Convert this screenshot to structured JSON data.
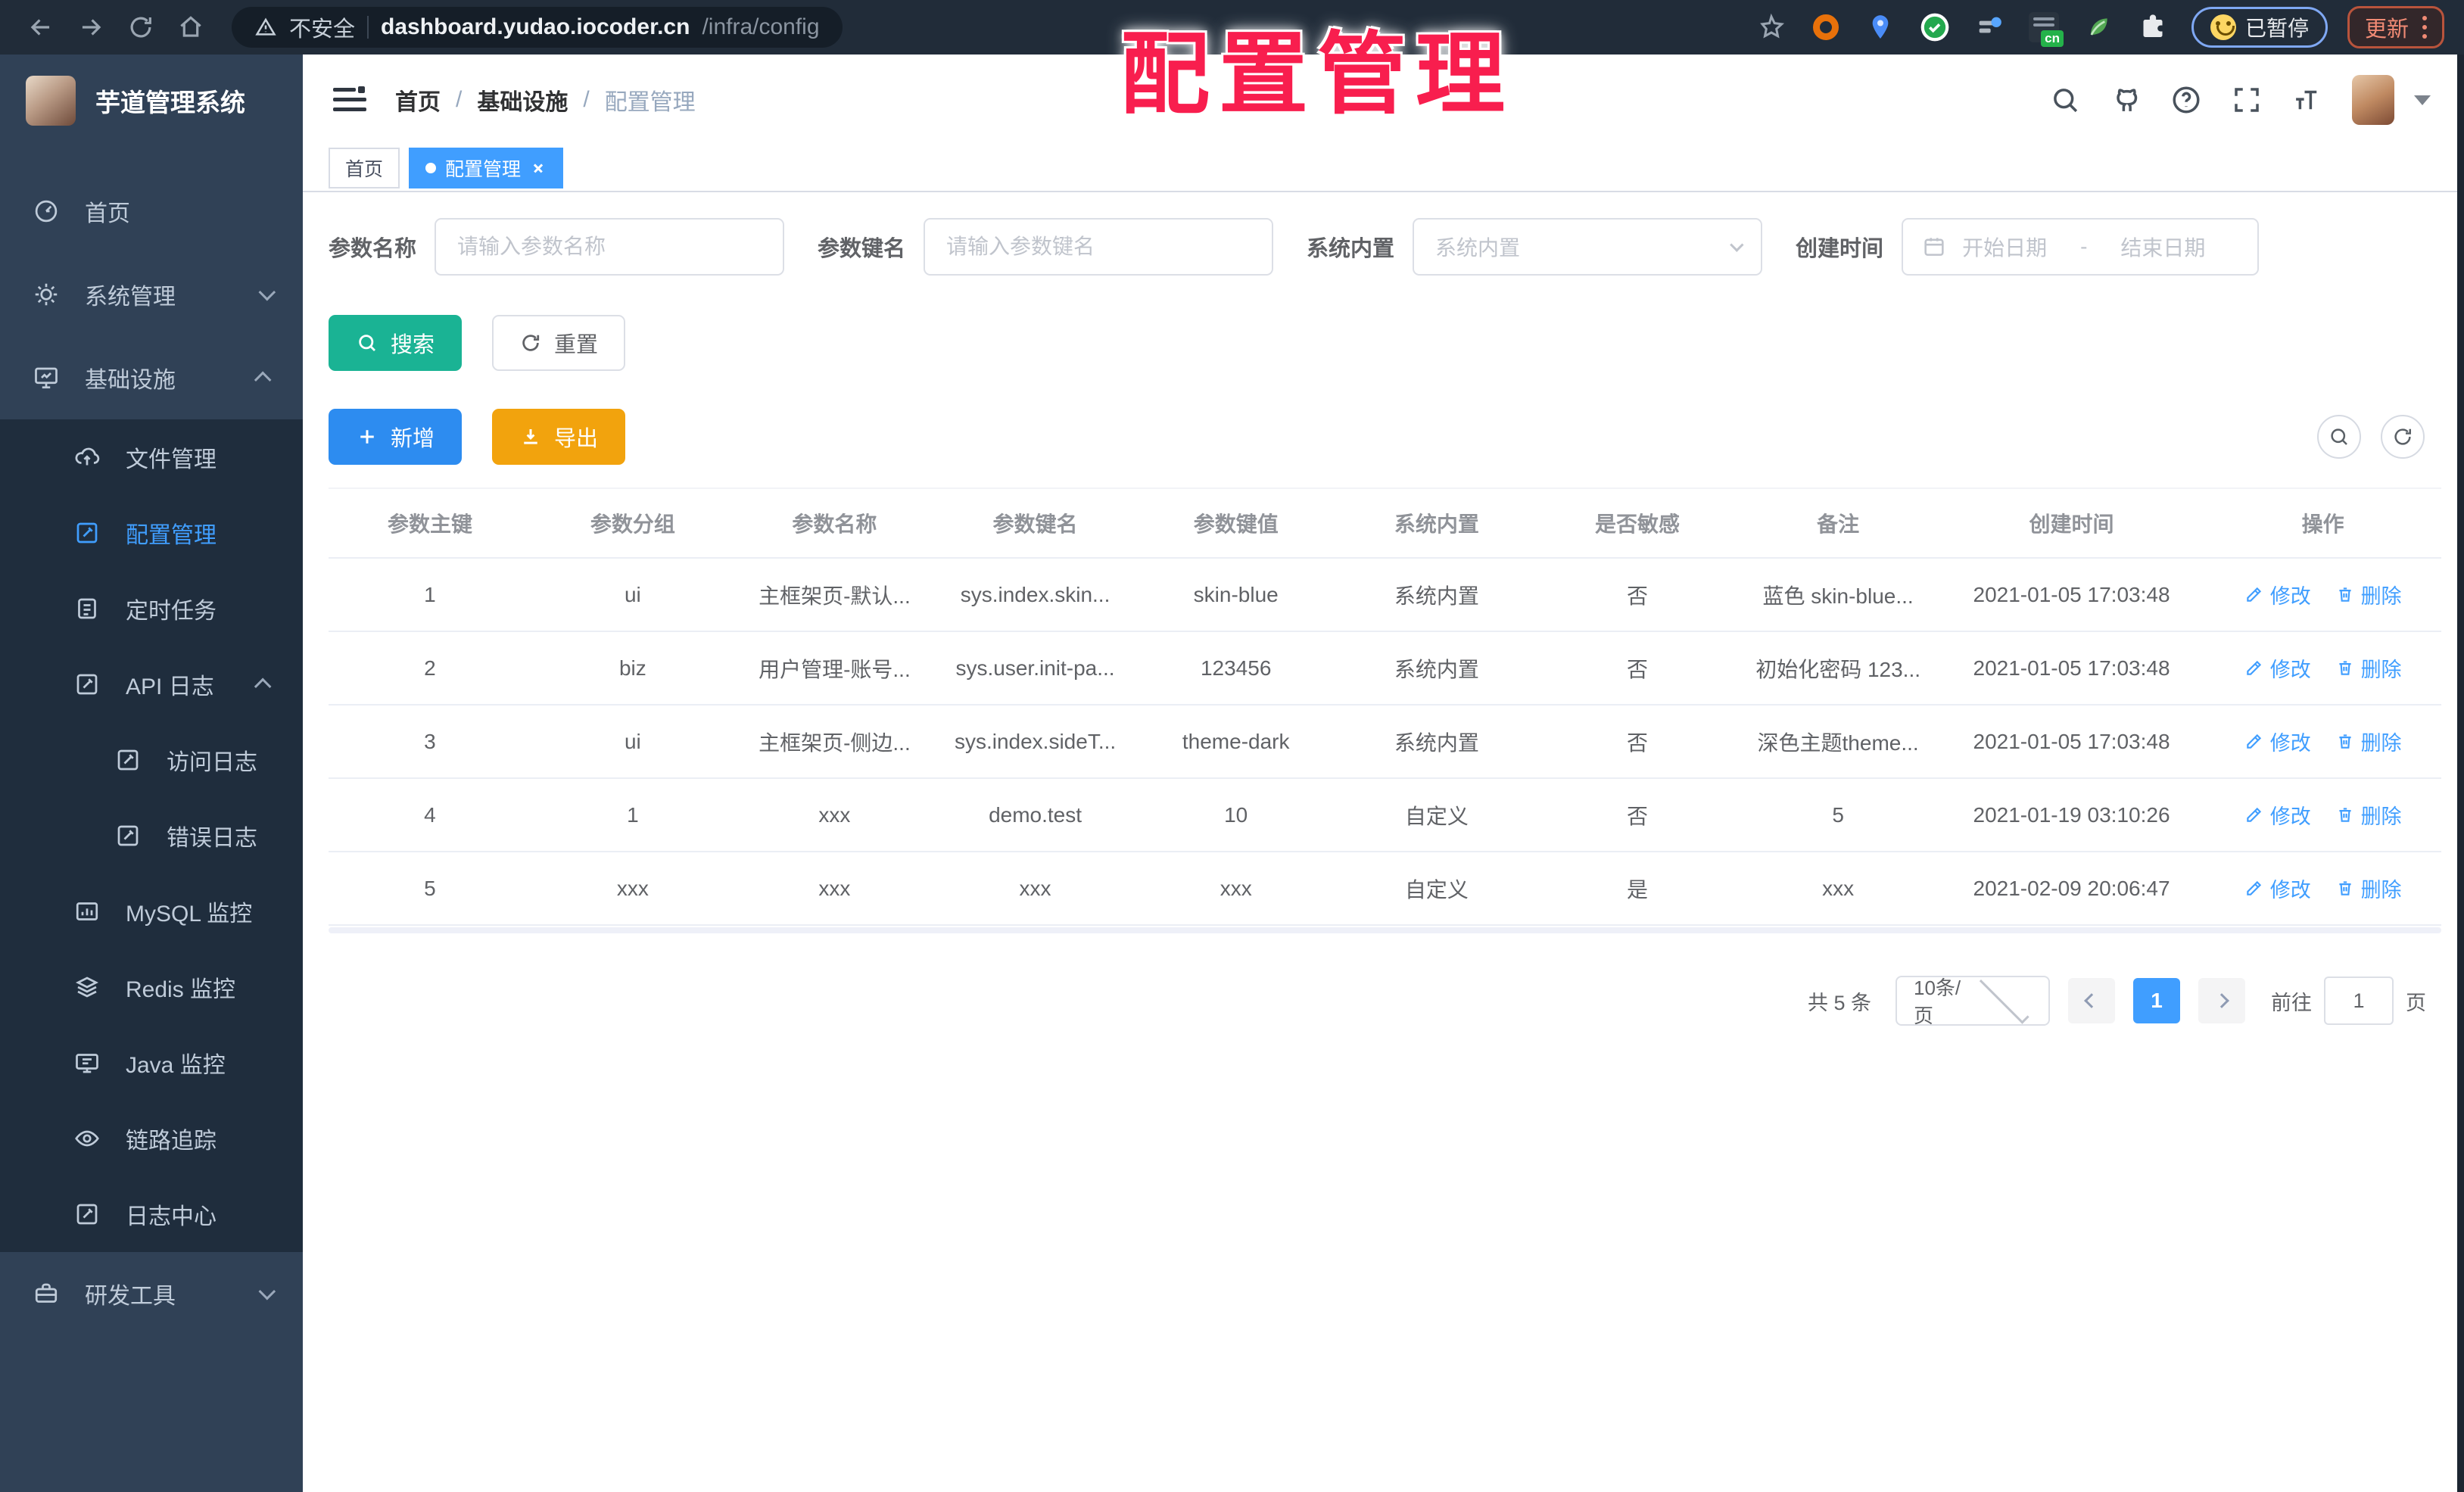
{
  "browser": {
    "security_label": "不安全",
    "url_host": "dashboard.yudao.iocoder.cn",
    "url_path": "/infra/config",
    "cn_badge": "cn",
    "paused_label": "已暂停",
    "update_label": "更新"
  },
  "watermark": "配置管理",
  "sidebar": {
    "title": "芋道管理系统",
    "items": [
      {
        "label": "首页"
      },
      {
        "label": "系统管理"
      },
      {
        "label": "基础设施"
      },
      {
        "label": "文件管理"
      },
      {
        "label": "配置管理"
      },
      {
        "label": "定时任务"
      },
      {
        "label": "API 日志"
      },
      {
        "label": "访问日志"
      },
      {
        "label": "错误日志"
      },
      {
        "label": "MySQL 监控"
      },
      {
        "label": "Redis 监控"
      },
      {
        "label": "Java 监控"
      },
      {
        "label": "链路追踪"
      },
      {
        "label": "日志中心"
      },
      {
        "label": "研发工具"
      }
    ]
  },
  "breadcrumb": {
    "items": [
      "首页",
      "基础设施",
      "配置管理"
    ],
    "separator": "/"
  },
  "tabs": [
    {
      "label": "首页"
    },
    {
      "label": "配置管理"
    }
  ],
  "filters": {
    "name_label": "参数名称",
    "name_placeholder": "请输入参数名称",
    "key_label": "参数键名",
    "key_placeholder": "请输入参数键名",
    "type_label": "系统内置",
    "type_placeholder": "系统内置",
    "date_label": "创建时间",
    "date_start_placeholder": "开始日期",
    "date_separator": "-",
    "date_end_placeholder": "结束日期"
  },
  "toolbar": {
    "search_label": "搜索",
    "reset_label": "重置",
    "add_label": "新增",
    "export_label": "导出"
  },
  "table": {
    "headers": [
      "参数主键",
      "参数分组",
      "参数名称",
      "参数键名",
      "参数键值",
      "系统内置",
      "是否敏感",
      "备注",
      "创建时间",
      "操作"
    ],
    "edit_label": "修改",
    "delete_label": "删除",
    "rows": [
      {
        "id": "1",
        "group": "ui",
        "name": "主框架页-默认...",
        "key": "sys.index.skin...",
        "value": "skin-blue",
        "builtin": "系统内置",
        "sensitive": "否",
        "remark": "蓝色 skin-blue...",
        "created": "2021-01-05 17:03:48"
      },
      {
        "id": "2",
        "group": "biz",
        "name": "用户管理-账号...",
        "key": "sys.user.init-pa...",
        "value": "123456",
        "builtin": "系统内置",
        "sensitive": "否",
        "remark": "初始化密码 123...",
        "created": "2021-01-05 17:03:48"
      },
      {
        "id": "3",
        "group": "ui",
        "name": "主框架页-侧边...",
        "key": "sys.index.sideT...",
        "value": "theme-dark",
        "builtin": "系统内置",
        "sensitive": "否",
        "remark": "深色主题theme...",
        "created": "2021-01-05 17:03:48"
      },
      {
        "id": "4",
        "group": "1",
        "name": "xxx",
        "key": "demo.test",
        "value": "10",
        "builtin": "自定义",
        "sensitive": "否",
        "remark": "5",
        "created": "2021-01-19 03:10:26"
      },
      {
        "id": "5",
        "group": "xxx",
        "name": "xxx",
        "key": "xxx",
        "value": "xxx",
        "builtin": "自定义",
        "sensitive": "是",
        "remark": "xxx",
        "created": "2021-02-09 20:06:47"
      }
    ]
  },
  "pagination": {
    "total": "共 5 条",
    "page_size": "10条/页",
    "current_page": "1",
    "goto_label": "前往",
    "goto_value": "1",
    "page_unit": "页"
  },
  "colors": {
    "accent": "#409eff",
    "sidebar_bg": "#304156",
    "submenu_bg": "#1f2d3d",
    "search_button": "#1ab394",
    "add_button": "#2d8cf0",
    "export_button": "#f2a30d",
    "watermark_red": "#f81e4e"
  }
}
